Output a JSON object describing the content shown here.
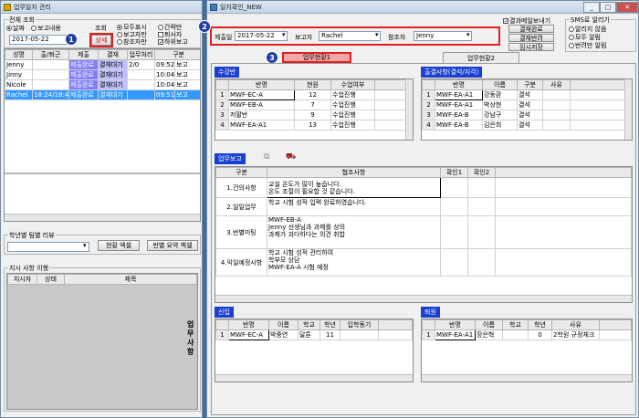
{
  "left_window": {
    "title": "업무일지 관리",
    "search_group": "전체 조회",
    "radio_date": "날짜",
    "radio_content": "보고내용",
    "date_value": "2017-05-22",
    "query_label": "조회",
    "detail_button": "상세",
    "radio_all": "모두표시",
    "radio_reporter_only": "보고자만",
    "radio_ref_only": "참조자만",
    "radio_simple": "간략만",
    "check_leave": "퇴사자",
    "check_subreport": "하위보고",
    "grid_headers": [
      "성명",
      "출/퇴근",
      "제출",
      "결재",
      "업무처리",
      "구분"
    ],
    "rows": [
      {
        "name": "Jenny",
        "time": "",
        "submit": "제출완료",
        "approval": "결재대기",
        "proc": "2/0",
        "clock": "09:52",
        "type": "보고"
      },
      {
        "name": "Jinny",
        "time": "",
        "submit": "제출완료",
        "approval": "결재대기",
        "proc": "",
        "clock": "10:04",
        "type": "보고"
      },
      {
        "name": "Nicole",
        "time": "",
        "submit": "제출완료",
        "approval": "결재대기",
        "proc": "",
        "clock": "10:04",
        "type": "보고"
      },
      {
        "name": "Rachel",
        "time": "18:24/18:47",
        "submit": "제출완료",
        "approval": "결재대기",
        "proc": "",
        "clock": "09:51",
        "type": "보고"
      }
    ],
    "team_review_group": "학년별 팀별 리뷰",
    "status_excel_button": "현황 엑셀",
    "class_summary_excel_button": "반별 요약 엑셀",
    "instruction_group": "지시 사항 이행",
    "instr_headers": [
      "지시자",
      "상태",
      "제목"
    ],
    "side_text": "업무사항"
  },
  "right_window": {
    "title": "일지확인_NEW",
    "filter_date_label": "제출일",
    "filter_date_value": "2017-05-22",
    "reporter_label": "보고자",
    "reporter_value": "Rachel",
    "ref_label": "참조자",
    "ref_value": "Jenny",
    "check_send_mail": "결과메일보내기",
    "btn_approve_done": "결재완료",
    "btn_approve_reject": "결재반려",
    "btn_temp_save": "임시저장",
    "sms_group": "SMS로 알리기",
    "sms_none": "알리지 않음",
    "sms_all": "모두 알림",
    "sms_reject_only": "반려만 알림",
    "tab1": "업무현황1",
    "tab2": "업무현황2",
    "class_section": "수강반",
    "class_headers": [
      "반명",
      "현원",
      "수업여부"
    ],
    "class_rows": [
      [
        "MWF-EC-A",
        "12",
        "수업진행"
      ],
      [
        "MWF-EB-A",
        "7",
        "수업진행"
      ],
      [
        "저팔반",
        "9",
        "수업진행"
      ],
      [
        "MWF-EA-A1",
        "13",
        "수업진행"
      ]
    ],
    "attend_section": "출결사항(결석/지각)",
    "attend_headers": [
      "반명",
      "이름",
      "구분",
      "사유"
    ],
    "attend_rows": [
      [
        "MWF-EA-A1",
        "강동환",
        "결석",
        ""
      ],
      [
        "MWF-EA-A1",
        "박상현",
        "결석",
        ""
      ],
      [
        "MWF-EA-B",
        "강남구",
        "결석",
        ""
      ],
      [
        "MWF-EA-B",
        "김은희",
        "결석",
        ""
      ]
    ],
    "work_section": "업무보고",
    "work_headers": [
      "구분",
      "협조사항",
      "확인1",
      "확인2"
    ],
    "work_rows": [
      {
        "cat": "1.건의사항",
        "lines": [
          "교실 온도가 많이 높습니다.",
          "온도 조절이 필요할 것 같습니다."
        ]
      },
      {
        "cat": "2.일일업무",
        "lines": [
          "학교 시험 성적 입력 완료하였습니다."
        ]
      },
      {
        "cat": "3.반별미팅",
        "lines": [
          "MWF-EB-A",
          "Jenny 선생님과 과제를 상의",
          "",
          "과제가 과다하다는 의견 취합"
        ]
      },
      {
        "cat": "4.익일예정사항",
        "lines": [
          "학교 시험 성적 관리하여",
          "학부모 상담",
          "MWF-EA-A 시험 예정"
        ]
      }
    ],
    "new_section": "신입",
    "new_headers": [
      "반명",
      "이름",
      "학교",
      "학년",
      "입학동기"
    ],
    "new_rows": [
      [
        "MWF-EC-A",
        "박중연",
        "달튼",
        "11",
        ""
      ]
    ],
    "leave_section": "퇴원",
    "leave_headers": [
      "반명",
      "이름",
      "학교",
      "학년",
      "사유"
    ],
    "leave_rows": [
      [
        "MWF-EA-A1",
        "장은혁",
        "",
        "0",
        "2학원 규정체크"
      ]
    ]
  },
  "badges": [
    "1",
    "2",
    "3"
  ]
}
